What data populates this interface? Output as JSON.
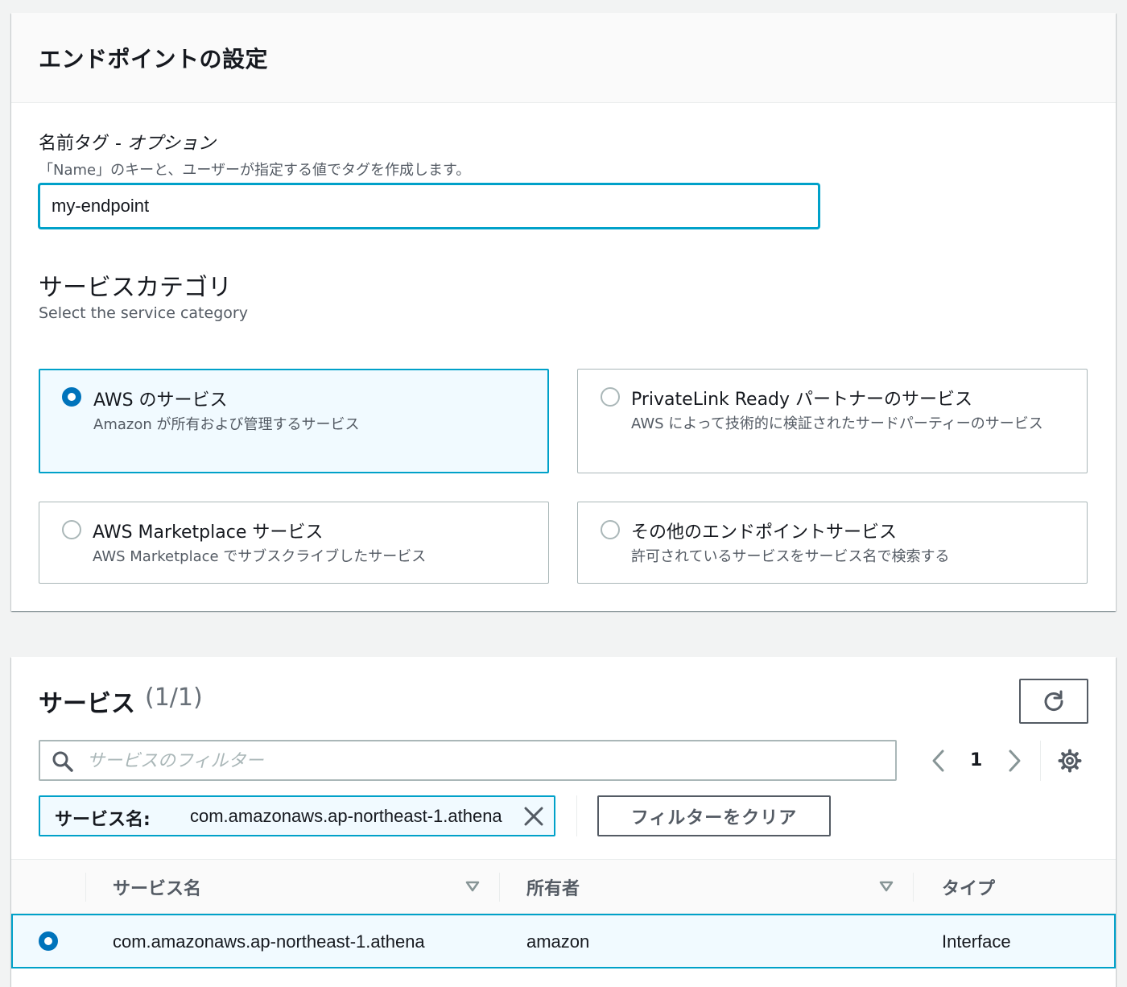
{
  "settings": {
    "title": "エンドポイントの設定",
    "name_tag": {
      "label": "名前タグ - ",
      "label_optional": "オプション",
      "description": "「Name」のキーと、ユーザーが指定する値でタグを作成します。",
      "value": "my-endpoint"
    },
    "service_category": {
      "title": "サービスカテゴリ",
      "description": "Select the service category",
      "options": [
        {
          "title": "AWS のサービス",
          "description": "Amazon が所有および管理するサービス",
          "selected": true
        },
        {
          "title": "PrivateLink Ready パートナーのサービス",
          "description": "AWS によって技術的に検証されたサードパーティーのサービス",
          "selected": false
        },
        {
          "title": "AWS Marketplace サービス",
          "description": "AWS Marketplace でサブスクライブしたサービス",
          "selected": false
        },
        {
          "title": "その他のエンドポイントサービス",
          "description": "許可されているサービスをサービス名で検索する",
          "selected": false
        }
      ]
    }
  },
  "services": {
    "title": "サービス",
    "count": "(1/1)",
    "search_placeholder": "サービスのフィルター",
    "pagination": {
      "current_page": "1"
    },
    "filter_token": {
      "key": "サービス名:",
      "value": "com.amazonaws.ap-northeast-1.athena"
    },
    "clear_filters_label": "フィルターをクリア",
    "table": {
      "columns": [
        "サービス名",
        "所有者",
        "タイプ"
      ],
      "rows": [
        {
          "service_name": "com.amazonaws.ap-northeast-1.athena",
          "owner": "amazon",
          "type": "Interface",
          "selected": true
        }
      ]
    }
  },
  "colors": {
    "accent": "#00a1c9",
    "radio_selected": "#0073bb",
    "selected_bg": "#f1faff",
    "border": "#aab7b8"
  }
}
